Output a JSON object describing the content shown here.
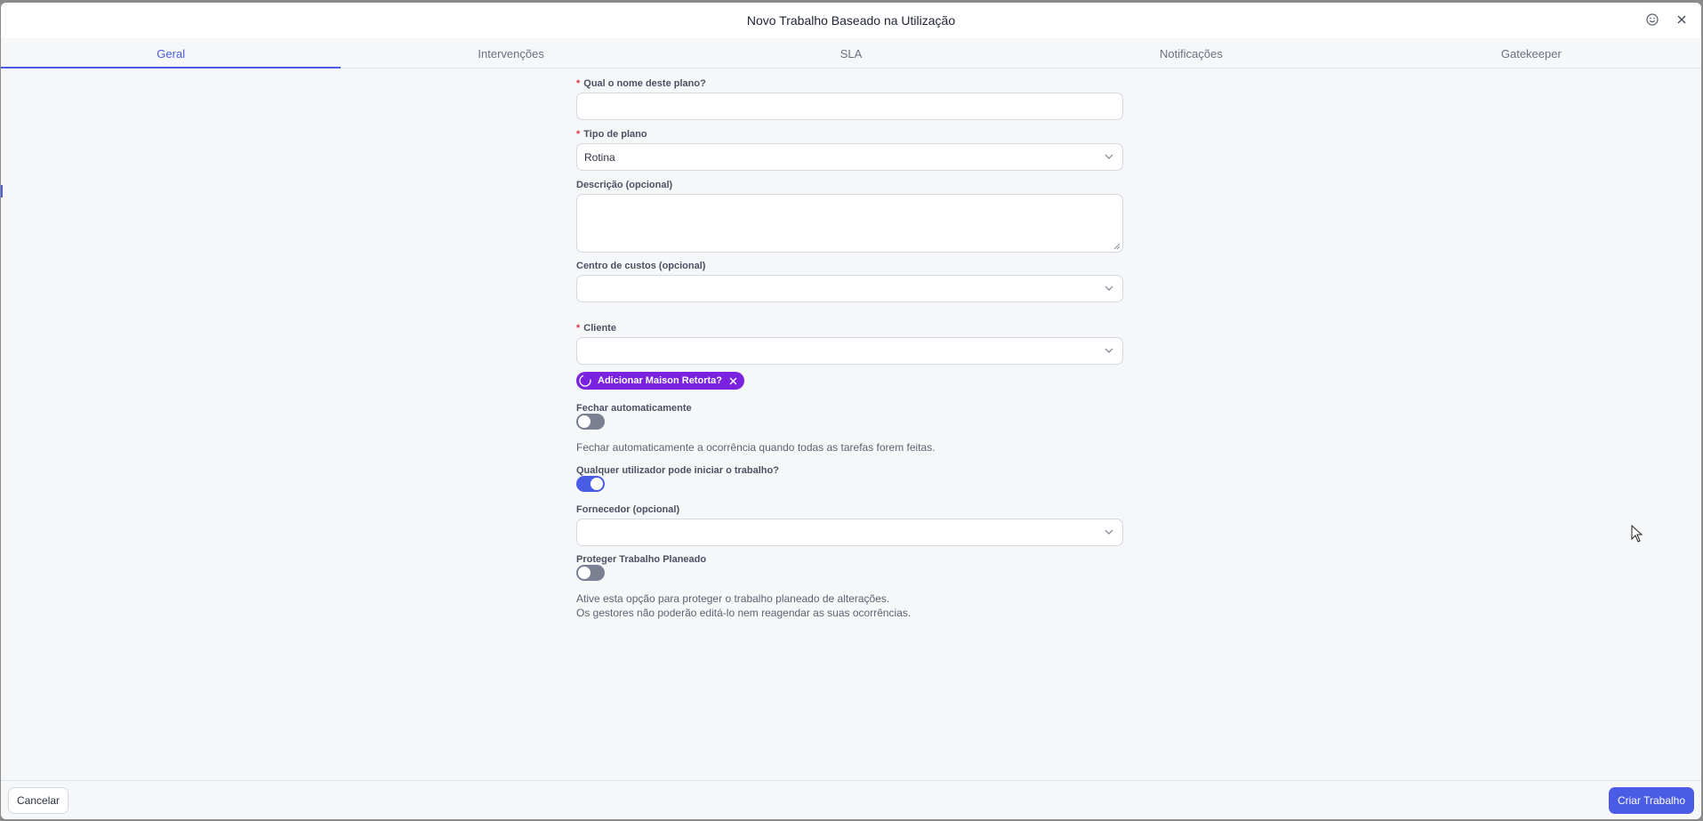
{
  "window": {
    "title": "Novo Trabalho Baseado na Utilização"
  },
  "icons": {
    "feedback": "smiley-icon",
    "close": "close-icon",
    "chevron": "chevron-down-icon",
    "spinner": "refresh-icon",
    "remove": "x-icon"
  },
  "tabs": [
    {
      "label": "Geral",
      "active": true
    },
    {
      "label": "Intervenções"
    },
    {
      "label": "SLA"
    },
    {
      "label": "Notificações"
    },
    {
      "label": "Gatekeeper"
    }
  ],
  "form": {
    "plan_name": {
      "label": "Qual o nome deste plano?",
      "required": "*",
      "value": ""
    },
    "plan_type": {
      "label": "Tipo de plano",
      "required": "*",
      "value": "Rotina"
    },
    "description": {
      "label": "Descrição (opcional)",
      "value": ""
    },
    "cost_center": {
      "label": "Centro de custos (opcional)",
      "value": ""
    },
    "client": {
      "label": "Cliente",
      "required": "*",
      "value": ""
    },
    "suggestion_chip": {
      "prefix": "Adicionar ",
      "name": "Maison Retorta?"
    },
    "auto_close": {
      "label": "Fechar automaticamente",
      "enabled": false,
      "help": "Fechar automaticamente a ocorrência quando todas as tarefas forem feitas."
    },
    "any_user_start": {
      "label": "Qualquer utilizador pode iniciar o trabalho?",
      "enabled": true
    },
    "supplier": {
      "label": "Fornecedor (opcional)",
      "value": ""
    },
    "protect": {
      "label": "Proteger Trabalho Planeado",
      "enabled": false,
      "help_line1": "Ative esta opção para proteger o trabalho planeado de alterações.",
      "help_line2": "Os gestores não poderão editá-lo nem reagendar as suas ocorrências."
    }
  },
  "footer": {
    "cancel_label": "Cancelar",
    "create_label": "Criar Trabalho"
  },
  "colors": {
    "accent": "#4a5be6",
    "chip": "#7a22e0",
    "required": "#e0344a"
  }
}
